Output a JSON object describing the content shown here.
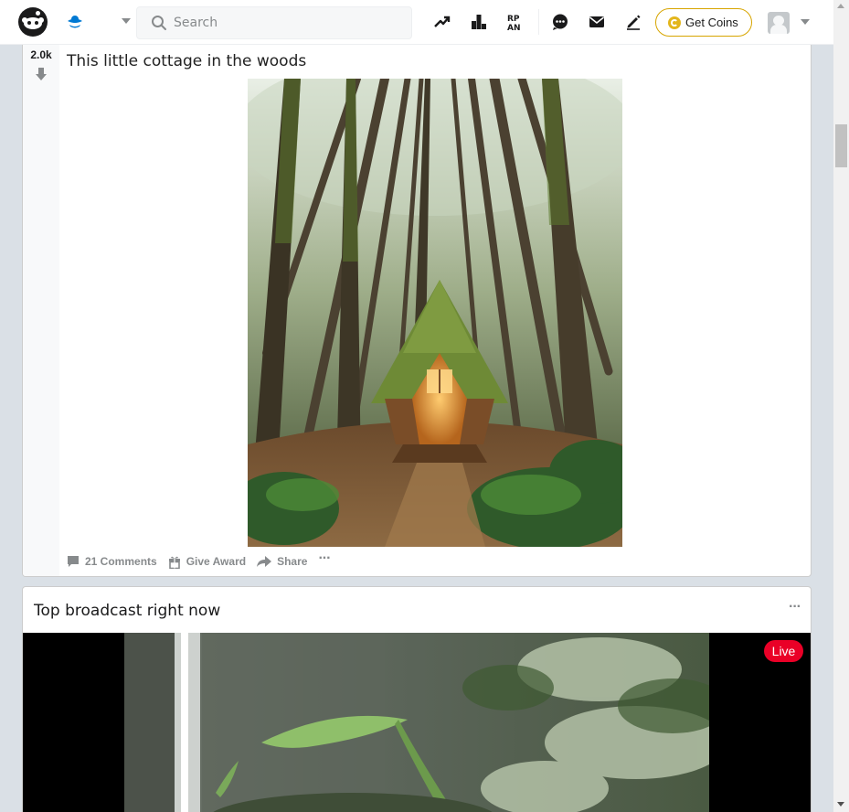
{
  "header": {
    "logo_icon": "reddit-logo-icon",
    "home_icon": "reddit-home-icon",
    "search": {
      "placeholder": "Search",
      "value": ""
    },
    "icons": [
      "trending-icon",
      "leaderboard-icon",
      "rpan-icon",
      "chat-icon",
      "mail-icon",
      "pencil-icon"
    ],
    "get_coins_label": "Get Coins",
    "coin_color": "#e3b61c",
    "user_icon": "user-avatar-icon"
  },
  "post": {
    "vote_count": "2.0k",
    "title": "This little cottage in the woods",
    "image_alt": "cottage in the woods",
    "actions": {
      "comments": "21 Comments",
      "award": "Give Award",
      "share": "Share",
      "more": "···"
    }
  },
  "broadcast": {
    "title": "Top broadcast right now",
    "menu": "···",
    "live_label": "Live",
    "live_color": "#ea0027"
  },
  "colors": {
    "page_bg": "#dae0e6",
    "card_bg": "#ffffff",
    "muted_text": "#878a8c"
  }
}
